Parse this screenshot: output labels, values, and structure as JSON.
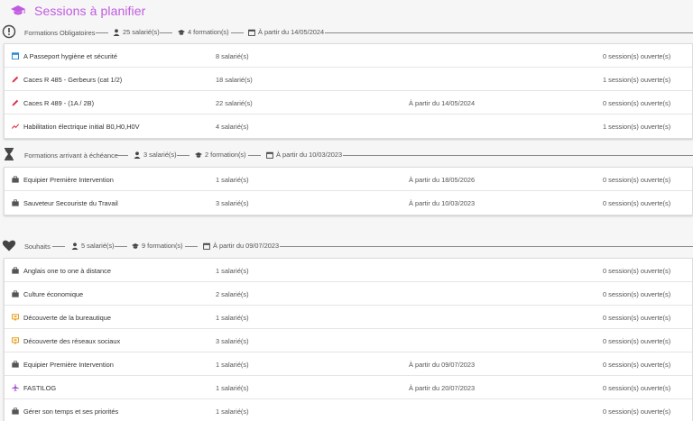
{
  "header": {
    "title": "Sessions à planifier",
    "icon": "graduation-cap-icon",
    "color": "#c05be0"
  },
  "sections": [
    {
      "title": "Formations Obligatoires",
      "icon": "exclamation-circle-icon",
      "salaries": "25 salarié(s)",
      "formations": "4 formation(s)",
      "date": "À partir du 14/05/2024",
      "rows": [
        {
          "icon": "calendar-icon",
          "icon_color": "#2a8ad4",
          "name": "A Passeport hygiène et sécurité",
          "count": "8 salarié(s)",
          "date": "",
          "sessions": "0 session(s) ouverte(s)"
        },
        {
          "icon": "pencil-icon",
          "icon_color": "#e0304a",
          "name": "Caces R 485 - Gerbeurs (cat 1/2)",
          "count": "18 salarié(s)",
          "date": "",
          "sessions": "1 session(s) ouverte(s)"
        },
        {
          "icon": "pencil-icon",
          "icon_color": "#e0304a",
          "name": "Caces R 489 - (1A / 2B)",
          "count": "22 salarié(s)",
          "date": "À partir du 14/05/2024",
          "sessions": "0 session(s) ouverte(s)"
        },
        {
          "icon": "trend-icon",
          "icon_color": "#e0304a",
          "name": "Habilitation électrique initial B0,H0,H0V",
          "count": "4 salarié(s)",
          "date": "",
          "sessions": "1 session(s) ouverte(s)"
        }
      ]
    },
    {
      "title": "Formations arrivant à échéance",
      "icon": "hourglass-icon",
      "salaries": "3 salarié(s)",
      "formations": "2 formation(s)",
      "date": "À partir du 10/03/2023",
      "rows": [
        {
          "icon": "briefcase-icon",
          "icon_color": "#555555",
          "name": "Equipier Première Intervention",
          "count": "1 salarié(s)",
          "date": "À partir du 18/05/2026",
          "sessions": "0 session(s) ouverte(s)"
        },
        {
          "icon": "briefcase-icon",
          "icon_color": "#555555",
          "name": "Sauveteur Secouriste du Travail",
          "count": "3 salarié(s)",
          "date": "À partir du 10/03/2023",
          "sessions": "0 session(s) ouverte(s)"
        }
      ]
    },
    {
      "title": "Souhaits",
      "icon": "heart-icon",
      "salaries": "5 salarié(s)",
      "formations": "9 formation(s)",
      "date": "À partir du 09/07/2023",
      "rows": [
        {
          "icon": "briefcase-icon",
          "icon_color": "#555555",
          "name": "Anglais one to one à distance",
          "count": "1 salarié(s)",
          "date": "",
          "sessions": "0 session(s) ouverte(s)"
        },
        {
          "icon": "briefcase-icon",
          "icon_color": "#555555",
          "name": "Culture économique",
          "count": "2 salarié(s)",
          "date": "",
          "sessions": "0 session(s) ouverte(s)"
        },
        {
          "icon": "monitor-icon",
          "icon_color": "#e8a020",
          "name": "Découverte de la bureautique",
          "count": "1 salarié(s)",
          "date": "",
          "sessions": "0 session(s) ouverte(s)"
        },
        {
          "icon": "monitor-icon",
          "icon_color": "#e8a020",
          "name": "Découverte des réseaux sociaux",
          "count": "3 salarié(s)",
          "date": "",
          "sessions": "0 session(s) ouverte(s)"
        },
        {
          "icon": "briefcase-icon",
          "icon_color": "#555555",
          "name": "Equipier Première Intervention",
          "count": "1 salarié(s)",
          "date": "À partir du 09/07/2023",
          "sessions": "0 session(s) ouverte(s)"
        },
        {
          "icon": "plane-icon",
          "icon_color": "#9b3fd0",
          "name": "FASTILOG",
          "count": "1 salarié(s)",
          "date": "À partir du 20/07/2023",
          "sessions": "0 session(s) ouverte(s)"
        },
        {
          "icon": "briefcase-icon",
          "icon_color": "#555555",
          "name": "Gérer son temps et ses priorités",
          "count": "1 salarié(s)",
          "date": "",
          "sessions": "0 session(s) ouverte(s)"
        }
      ]
    }
  ]
}
